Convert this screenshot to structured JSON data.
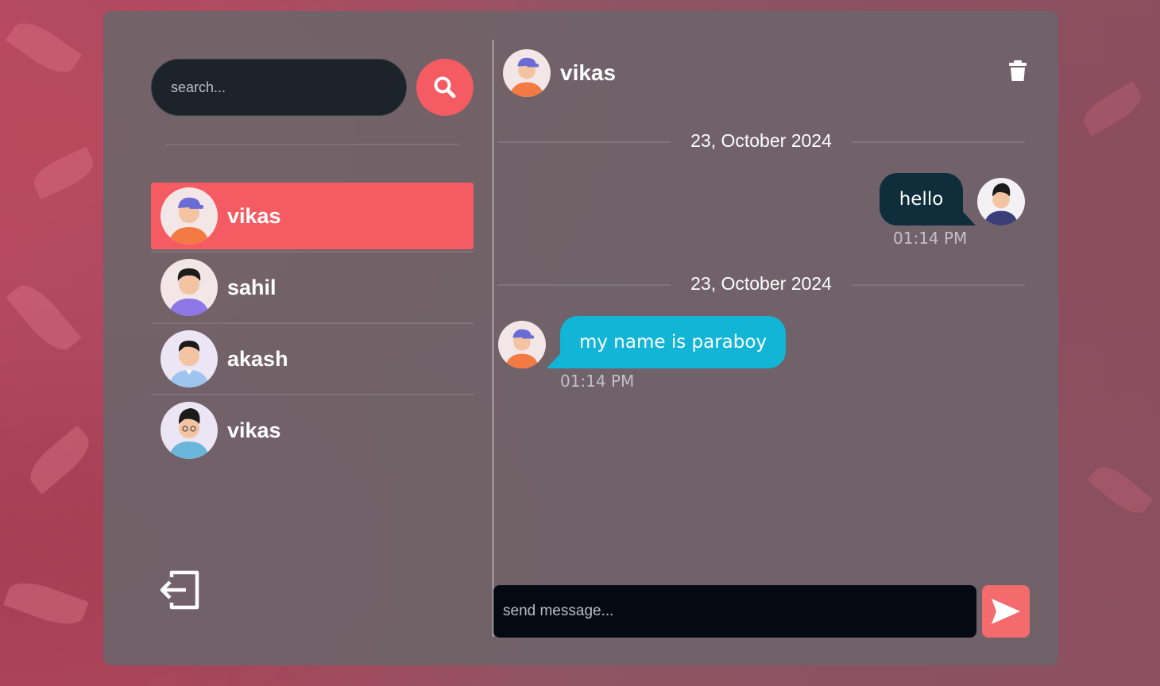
{
  "search": {
    "placeholder": "search..."
  },
  "contacts": [
    {
      "name": "vikas",
      "active": true
    },
    {
      "name": "sahil",
      "active": false
    },
    {
      "name": "akash",
      "active": false
    },
    {
      "name": "vikas",
      "active": false
    }
  ],
  "chat": {
    "header_name": "vikas",
    "messages": [
      {
        "date": "23, October 2024",
        "text": "hello",
        "time": "01:14 PM",
        "direction": "outgoing"
      },
      {
        "date": "23, October 2024",
        "text": "my name is paraboy",
        "time": "01:14 PM",
        "direction": "incoming"
      }
    ],
    "input_placeholder": "send message..."
  },
  "icons": {
    "search": "search-icon",
    "logout": "logout-icon",
    "trash": "trash-icon",
    "send": "send-icon"
  },
  "colors": {
    "accent": "#f45b62",
    "outgoing_bubble": "#0f2e3c",
    "incoming_bubble": "#12b5d6",
    "input_bg": "#050a12"
  }
}
